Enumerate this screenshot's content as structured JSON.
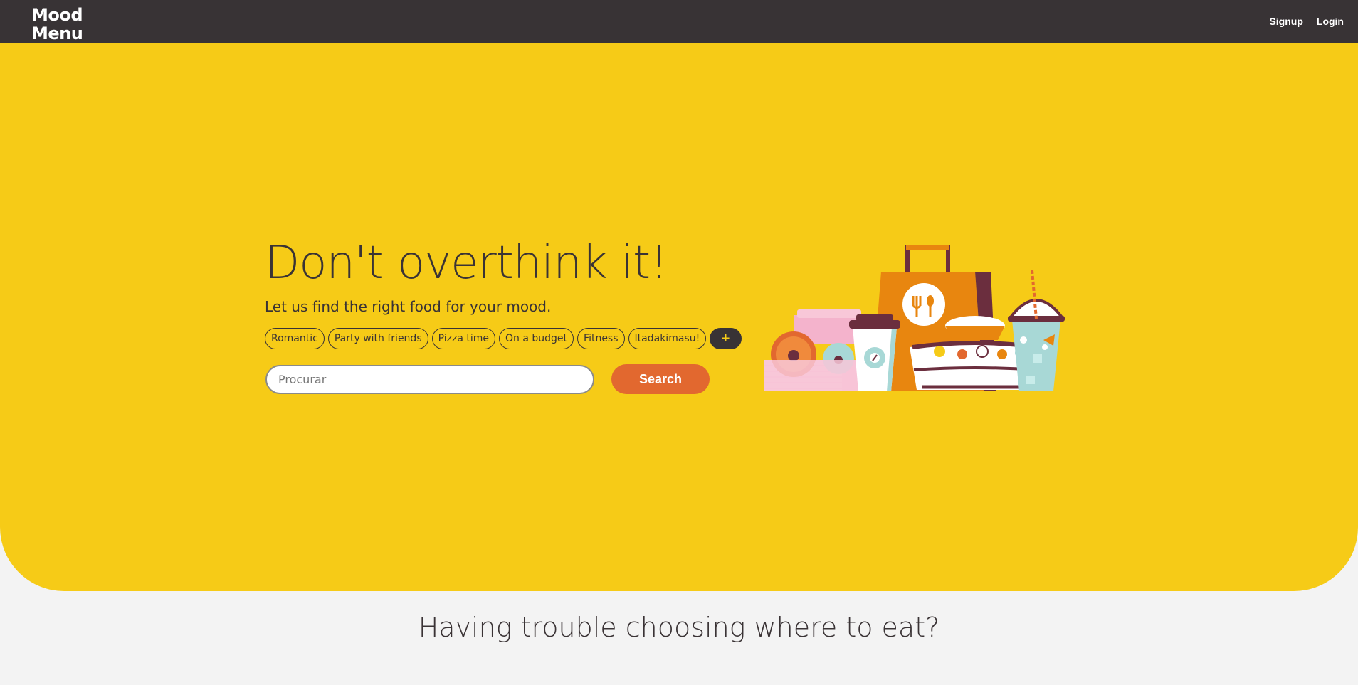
{
  "brand": {
    "line1": "Mood",
    "line2": "Menu"
  },
  "nav": {
    "signup": "Signup",
    "login": "Login"
  },
  "hero": {
    "headline": "Don't overthink it!",
    "subhead": "Let us find the right food for your mood.",
    "tags": [
      "Romantic",
      "Party with friends",
      "Pizza time",
      "On a budget",
      "Fitness",
      "Itadakimasu!"
    ],
    "add_tag": "+",
    "search": {
      "placeholder": "Procurar",
      "value": "",
      "button": "Search"
    }
  },
  "section": {
    "title": "Having trouble choosing where to eat?"
  },
  "colors": {
    "accent": "#f6cb17",
    "dark": "#383335",
    "button": "#e2682f",
    "background": "#f3f3f3"
  }
}
